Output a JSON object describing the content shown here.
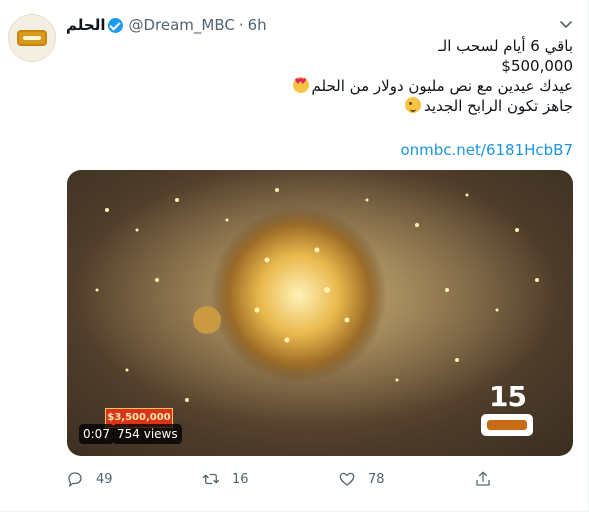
{
  "tweet": {
    "display_name": "الحلم",
    "handle": "@Dream_MBC",
    "separator": "·",
    "time": "6h",
    "lines": [
      "باقي 6 أيام لسحب الـ",
      "$500,000",
      "عيدك عيدين مع نص مليون دولار من الحلم",
      "جاهز تكون الرابح الجديد"
    ],
    "link": "onmbc.net/6181HcbB7",
    "media": {
      "duration": "0:07",
      "views": "754 views",
      "price_tag": "$3,500,000",
      "brand_number": "15"
    },
    "actions": {
      "replies": "49",
      "retweets": "16",
      "likes": "78"
    }
  },
  "icons": [
    "verified-badge-icon",
    "chevron-down-icon",
    "reply-icon",
    "retweet-icon",
    "like-icon",
    "share-icon"
  ],
  "colors": {
    "accent": "#1d9bf0",
    "link": "#1b95e0",
    "muted": "#536471"
  }
}
